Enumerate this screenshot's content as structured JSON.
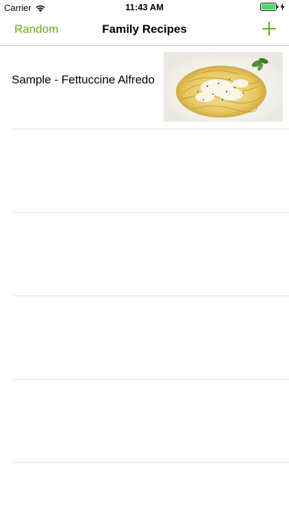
{
  "status_bar": {
    "carrier": "Carrier",
    "time": "11:43 AM",
    "icons": [
      "wifi-icon",
      "battery-icon",
      "charging-icon"
    ],
    "battery_color": "#4cd964"
  },
  "nav": {
    "left_button": "Random",
    "title": "Family Recipes",
    "right_icon": "plus-icon",
    "tint_color": "#6aa81a"
  },
  "recipes": [
    {
      "title": "Sample - Fettuccine Alfredo",
      "image": "fettuccine-alfredo-photo"
    }
  ]
}
